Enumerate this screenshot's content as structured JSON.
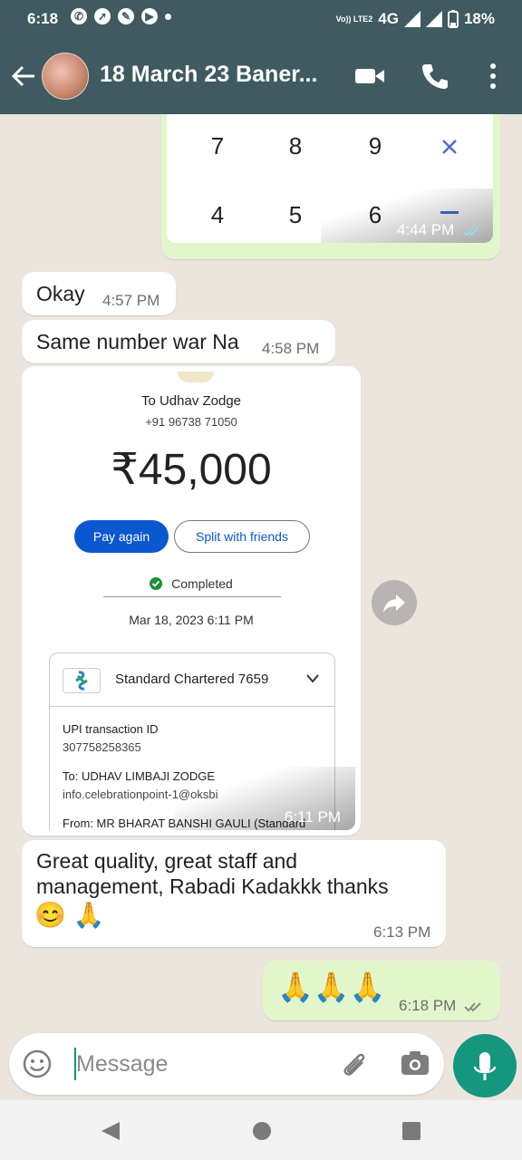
{
  "status_bar": {
    "time": "6:18",
    "network": "4G",
    "battery": "18%",
    "carrier_badge": "Vo)) LTE2"
  },
  "header": {
    "title": "18 March 23 Baner..."
  },
  "keypad_image": {
    "keys_row1": [
      "7",
      "8",
      "9"
    ],
    "keys_row2": [
      "4",
      "5",
      "6"
    ],
    "time": "4:44 PM"
  },
  "messages": [
    {
      "text": "Okay",
      "time": "4:57 PM"
    },
    {
      "text": "Same number war Na",
      "time": "4:58 PM"
    }
  ],
  "payment_screenshot": {
    "to": "To Udhav Zodge",
    "phone": "+91 96738 71050",
    "amount": "₹45,000",
    "pay_again": "Pay again",
    "split": "Split with friends",
    "status": "Completed",
    "date": "Mar 18, 2023 6:11 PM",
    "bank": "Standard Chartered 7659",
    "upi_label": "UPI transaction ID",
    "upi_id": "307758258365",
    "to_full": "To: UDHAV LIMBAJI ZODGE",
    "to_vpa": "info.celebrationpoint-1@oksbi",
    "from": "From: MR BHARAT BANSHI GAULI (Standard",
    "time": "6:11 PM"
  },
  "review_message": {
    "line1": "Great quality, great staff and",
    "line2": "management, Rabadi Kadakkk thanks",
    "emojis": "😊 🙏",
    "time": "6:13 PM"
  },
  "sent_message": {
    "emojis": "🙏🙏🙏",
    "time": "6:18 PM"
  },
  "composer": {
    "placeholder": "Message"
  },
  "colors": {
    "header_bg": "#3f5a60",
    "outgoing_bubble": "#e1f7cb",
    "accent": "#14967f",
    "gpay_blue": "#0b57d0"
  }
}
